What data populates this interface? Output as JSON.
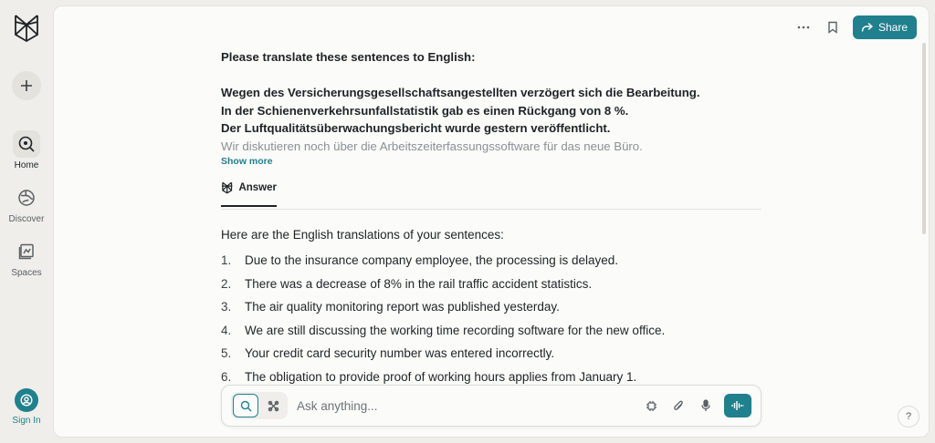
{
  "sidebar": {
    "logo_icon": "perplexity-logo-icon",
    "new_thread_icon": "plus-icon",
    "items": [
      {
        "label": "Home",
        "icon": "search-icon",
        "active": true
      },
      {
        "label": "Discover",
        "icon": "globe-icon",
        "active": false
      },
      {
        "label": "Spaces",
        "icon": "spaces-icon",
        "active": false
      }
    ],
    "signin_label": "Sign In"
  },
  "topbar": {
    "more_icon": "ellipsis-icon",
    "bookmark_icon": "bookmark-icon",
    "share_label": "Share"
  },
  "query": {
    "lines": [
      "Please translate these sentences to English:",
      "",
      "Wegen des Versicherungsgesellschaftsangestellten verzögert sich die Bearbeitung.",
      "In der Schienenverkehrsunfallstatistik gab es einen Rückgang von 8 %.",
      "Der Luftqualitätsüberwachungsbericht wurde gestern veröffentlicht.",
      "Wir diskutieren noch über die Arbeitszeiterfassungssoftware für das neue Büro."
    ],
    "show_more": "Show more"
  },
  "answer": {
    "tab_label": "Answer",
    "intro": "Here are the English translations of your sentences:",
    "items": [
      {
        "num": "1.",
        "text": "Due to the insurance company employee, the processing is delayed."
      },
      {
        "num": "2.",
        "text": "There was a decrease of 8% in the rail traffic accident statistics."
      },
      {
        "num": "3.",
        "text": "The air quality monitoring report was published yesterday."
      },
      {
        "num": "4.",
        "text": "We are still discussing the working time recording software for the new office."
      },
      {
        "num": "5.",
        "text": "Your credit card security number was entered incorrectly."
      },
      {
        "num": "6.",
        "text": "The obligation to provide proof of working hours applies from January 1."
      }
    ]
  },
  "ask": {
    "placeholder": "Ask anything..."
  },
  "help_label": "?",
  "colors": {
    "accent": "#20808d",
    "background": "#efeeea",
    "panel": "#fbfbf9"
  }
}
